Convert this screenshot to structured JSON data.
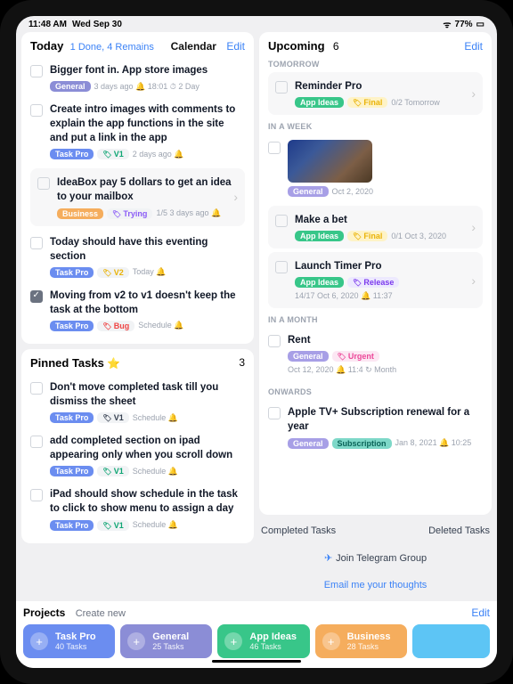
{
  "status": {
    "time": "11:48 AM",
    "date": "Wed Sep 30",
    "battery": "77%",
    "wifi": "⬩"
  },
  "today": {
    "title": "Today",
    "progress": "1 Done, 4 Remains",
    "calendar": "Calendar",
    "edit": "Edit",
    "tasks": [
      {
        "title": "Bigger font in. App store images",
        "badge": "General",
        "bcls": "general",
        "tags": [],
        "meta": "3 days ago  🔔 18:01  ⏱ 2 Day"
      },
      {
        "title": "Create intro images with comments to explain the app functions in the site and put a link in the app",
        "badge": "Task Pro",
        "bcls": "taskpro",
        "tags": [
          {
            "t": "V1",
            "c": "v1"
          }
        ],
        "meta": "2 days ago  🔔"
      },
      {
        "boxed": true,
        "title": "IdeaBox pay 5 dollars to get an idea to your mailbox",
        "badge": "Business",
        "bcls": "business",
        "tags": [
          {
            "t": "Trying",
            "c": "trying"
          }
        ],
        "meta": "1/5  3 days ago  🔔"
      },
      {
        "title": "Today should have this eventing section",
        "badge": "Task Pro",
        "bcls": "taskpro",
        "tags": [
          {
            "t": "V2",
            "c": "v2"
          }
        ],
        "meta": "Today  🔔"
      },
      {
        "done": true,
        "title": "Moving from v2 to v1 doesn't keep the task at the bottom",
        "badge": "Task Pro",
        "bcls": "taskpro",
        "tags": [
          {
            "t": "Bug",
            "c": "bug"
          }
        ],
        "meta": "Schedule  🔔"
      }
    ]
  },
  "pinned": {
    "title": "Pinned Tasks",
    "count": "3",
    "tasks": [
      {
        "title": "Don't move completed task till you dismiss the sheet",
        "badge": "Task Pro",
        "bcls": "taskpro",
        "tags": [
          {
            "t": "V1",
            "c": "v1n"
          }
        ],
        "meta": "Schedule  🔔"
      },
      {
        "title": "add completed section on ipad appearing only when you scroll down",
        "badge": "Task Pro",
        "bcls": "taskpro",
        "tags": [
          {
            "t": "V1",
            "c": "v1"
          }
        ],
        "meta": "Schedule  🔔"
      },
      {
        "title": "iPad should show schedule in the task to click to show menu to assign a day",
        "badge": "Task Pro",
        "bcls": "taskpro",
        "tags": [
          {
            "t": "V1",
            "c": "v1"
          }
        ],
        "meta": "Schedule  🔔"
      }
    ]
  },
  "upcoming": {
    "title": "Upcoming",
    "count": "6",
    "edit": "Edit",
    "groups": {
      "tomorrow": "TOMORROW",
      "week": "IN A WEEK",
      "month": "IN A MONTH",
      "onwards": "ONWARDS"
    },
    "items": {
      "reminder": {
        "title": "Reminder Pro",
        "badge": "App Ideas",
        "bcls": "appideas",
        "tag": "Final",
        "tcls": "final",
        "meta": "0/2  Tomorrow"
      },
      "image": {
        "badge": "General",
        "bcls": "generalalt",
        "meta": "Oct 2, 2020"
      },
      "bet": {
        "title": "Make a bet",
        "badge": "App Ideas",
        "bcls": "appideas",
        "tag": "Final",
        "tcls": "final",
        "meta": "0/1  Oct 3, 2020"
      },
      "launch": {
        "title": "Launch Timer Pro",
        "badge": "App Ideas",
        "bcls": "appideas",
        "tag": "Release",
        "tcls": "release",
        "meta": "14/17  Oct 6, 2020  🔔 11:37"
      },
      "rent": {
        "title": "Rent",
        "badge": "General",
        "bcls": "generalalt",
        "tag": "Urgent",
        "tcls": "urgent",
        "meta": "Oct 12, 2020  🔔 11:4  ↻ Month"
      },
      "apple": {
        "title": "Apple TV+ Subscription renewal for a year",
        "badge": "General",
        "bcls": "generalalt",
        "tag2": "Subscription",
        "meta": "Jan 8, 2021  🔔 10:25"
      }
    },
    "completed": "Completed Tasks",
    "deleted": "Deleted Tasks",
    "telegram": "Join Telegram Group",
    "email": "Email me your thoughts"
  },
  "projects": {
    "title": "Projects",
    "create": "Create new",
    "edit": "Edit",
    "list": [
      {
        "name": "Task Pro",
        "count": "40 Tasks",
        "cls": "p-taskpro"
      },
      {
        "name": "General",
        "count": "25 Tasks",
        "cls": "p-general"
      },
      {
        "name": "App Ideas",
        "count": "46 Tasks",
        "cls": "p-appideas"
      },
      {
        "name": "Business",
        "count": "28 Tasks",
        "cls": "p-business"
      }
    ]
  }
}
